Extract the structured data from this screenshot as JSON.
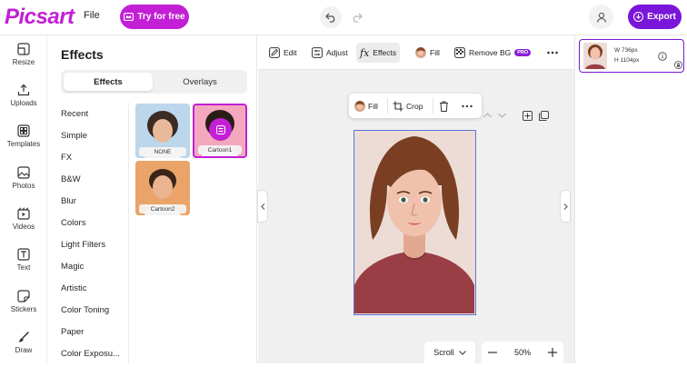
{
  "app": {
    "logo": "Picsart",
    "file_menu": "File",
    "try_label": "Try for free",
    "export_label": "Export"
  },
  "sidebar": {
    "items": [
      {
        "label": "Resize",
        "icon": "resize-icon"
      },
      {
        "label": "Uploads",
        "icon": "upload-icon"
      },
      {
        "label": "Templates",
        "icon": "templates-icon"
      },
      {
        "label": "Photos",
        "icon": "photo-icon"
      },
      {
        "label": "Videos",
        "icon": "video-icon"
      },
      {
        "label": "Text",
        "icon": "text-icon"
      },
      {
        "label": "Stickers",
        "icon": "sticker-icon"
      },
      {
        "label": "Draw",
        "icon": "brush-icon"
      }
    ]
  },
  "panel": {
    "title": "Effects",
    "tabs": [
      "Effects",
      "Overlays"
    ],
    "categories": [
      "Recent",
      "Simple",
      "FX",
      "B&W",
      "Blur",
      "Colors",
      "Light Filters",
      "Magic",
      "Artistic",
      "Color Toning",
      "Paper",
      "Color Exposu..."
    ],
    "thumbs": [
      {
        "label": "NONE"
      },
      {
        "label": "Cartoon1"
      },
      {
        "label": "Cartoon2"
      }
    ]
  },
  "toolbar": {
    "tools": [
      "Edit",
      "Adjust",
      "Effects",
      "Fill",
      "Remove BG"
    ],
    "pro_badge": "PRO",
    "active": "Effects"
  },
  "float_bar": {
    "fill": "Fill",
    "crop": "Crop"
  },
  "canvas": {
    "scroll_mode": "Scroll",
    "zoom": "50%"
  },
  "layer": {
    "width": "W 736px",
    "height": "H 1104px"
  },
  "colors": {
    "brand": "#c21fd6",
    "export": "#7a16d9",
    "selection": "#5b74d9"
  }
}
